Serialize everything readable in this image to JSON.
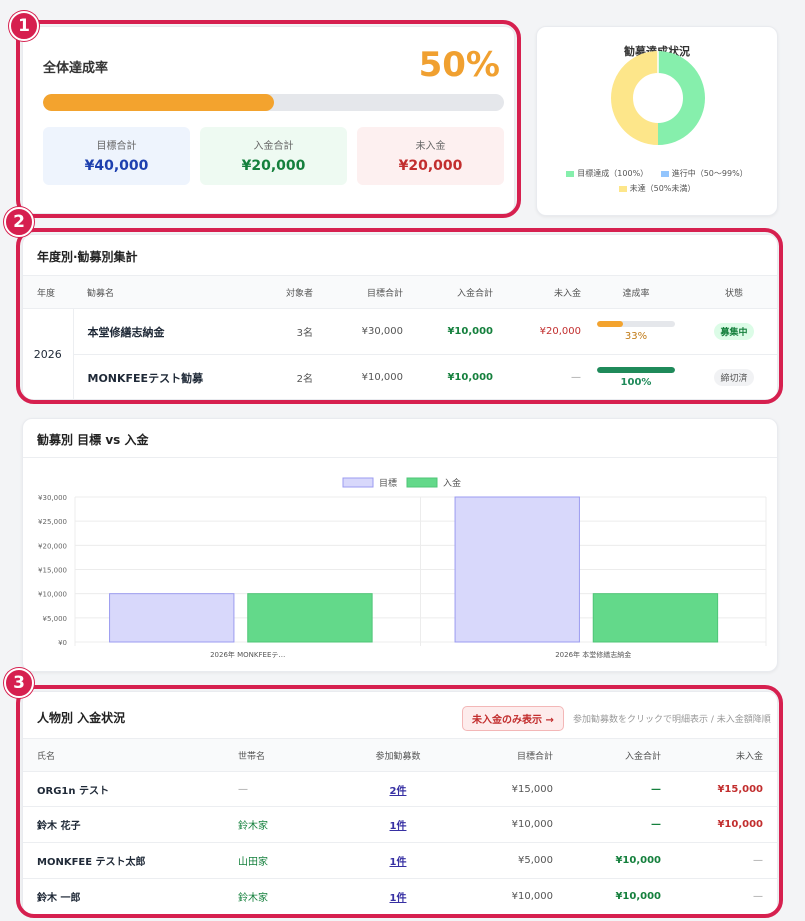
{
  "overall": {
    "title": "全体達成率",
    "percent_label": "50%",
    "progress": 0.5,
    "stats": [
      {
        "label": "目標合計",
        "value": "¥40,000"
      },
      {
        "label": "入金合計",
        "value": "¥20,000"
      },
      {
        "label": "未入金",
        "value": "¥20,000"
      }
    ]
  },
  "markers": [
    "1",
    "2",
    "3"
  ],
  "donut": {
    "title": "勧募達成状況",
    "legend": [
      "目標達成（100%）",
      "進行中（50〜99%）",
      "未達（50%未満）"
    ],
    "colors": [
      "#86efac",
      "#93c5fd",
      "#fde68a"
    ],
    "values": [
      1,
      0,
      1
    ]
  },
  "summary": {
    "title": "年度別·勧募別集計",
    "headers": [
      "年度",
      "勧募名",
      "対象者",
      "目標合計",
      "入金合計",
      "未入金",
      "達成率",
      "状態"
    ],
    "year": "2026",
    "rows": [
      {
        "name": "本堂修繕志納金",
        "members": "3名",
        "target": "¥30,000",
        "paid": "¥10,000",
        "unpaid": "¥20,000",
        "rate_label": "33%",
        "rate": 0.33,
        "status": "募集中"
      },
      {
        "name": "MONKFEEテスト勧募",
        "members": "2名",
        "target": "¥10,000",
        "paid": "¥10,000",
        "unpaid": "—",
        "rate_label": "100%",
        "rate": 1.0,
        "status": "締切済"
      }
    ]
  },
  "chart_data": {
    "type": "bar",
    "title": "勧募別 目標 vs 入金",
    "categories": [
      "2026年 MONKFEEテ…",
      "2026年 本堂修繕志納金"
    ],
    "series": [
      {
        "name": "目標",
        "values": [
          10000,
          30000
        ],
        "color": "#d8d8fb",
        "stroke": "#9b9bf0"
      },
      {
        "name": "入金",
        "values": [
          10000,
          10000
        ],
        "color": "#63d98a",
        "stroke": "#4fc577"
      }
    ],
    "yticks": [
      "¥0",
      "¥5,000",
      "¥10,000",
      "¥15,000",
      "¥20,000",
      "¥25,000",
      "¥30,000"
    ],
    "ylim": [
      0,
      30000
    ],
    "grid": true,
    "legend": "top"
  },
  "persons": {
    "title": "人物別 入金状況",
    "filter_button": "未入金のみ表示 →",
    "hint": "参加勧募数をクリックで明細表示 / 未入金額降順",
    "headers": [
      "氏名",
      "世帯名",
      "参加勧募数",
      "目標合計",
      "入金合計",
      "未入金"
    ],
    "rows": [
      {
        "name": "ORG1n テスト",
        "household": "—",
        "count": "2件",
        "target": "¥15,000",
        "paid": "—",
        "unpaid": "¥15,000"
      },
      {
        "name": "鈴木 花子",
        "household": "鈴木家",
        "count": "1件",
        "target": "¥10,000",
        "paid": "—",
        "unpaid": "¥10,000"
      },
      {
        "name": "MONKFEE テスト太郎",
        "household": "山田家",
        "count": "1件",
        "target": "¥5,000",
        "paid": "¥10,000",
        "unpaid": "—"
      },
      {
        "name": "鈴木 一郎",
        "household": "鈴木家",
        "count": "1件",
        "target": "¥10,000",
        "paid": "¥10,000",
        "unpaid": "—"
      }
    ]
  }
}
